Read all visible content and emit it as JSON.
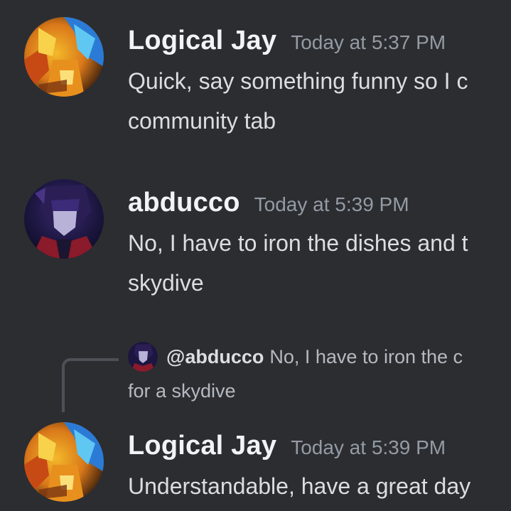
{
  "messages": [
    {
      "username": "Logical Jay",
      "timestamp": "Today at 5:37 PM",
      "lines": [
        "Quick, say something funny so I c",
        "community tab"
      ],
      "avatar_icon": "anime-avatar-icon"
    },
    {
      "username": "abducco",
      "timestamp": "Today at 5:39 PM",
      "lines": [
        "No, I have to iron the dishes and t",
        "skydive"
      ],
      "avatar_icon": "anime-avatar-icon"
    },
    {
      "reply": {
        "mention": "@abducco",
        "text_line1": "No, I have to iron the c",
        "text_line2": "for a skydive"
      },
      "username": "Logical Jay",
      "timestamp": "Today at 5:39 PM",
      "lines": [
        "Understandable, have a great day"
      ],
      "avatar_icon": "anime-avatar-icon"
    }
  ],
  "colors": {
    "background": "#2b2d31",
    "username": "#f2f3f5",
    "timestamp": "#949ba4",
    "text": "#dbdee1",
    "reply_text": "#b5bac1"
  }
}
